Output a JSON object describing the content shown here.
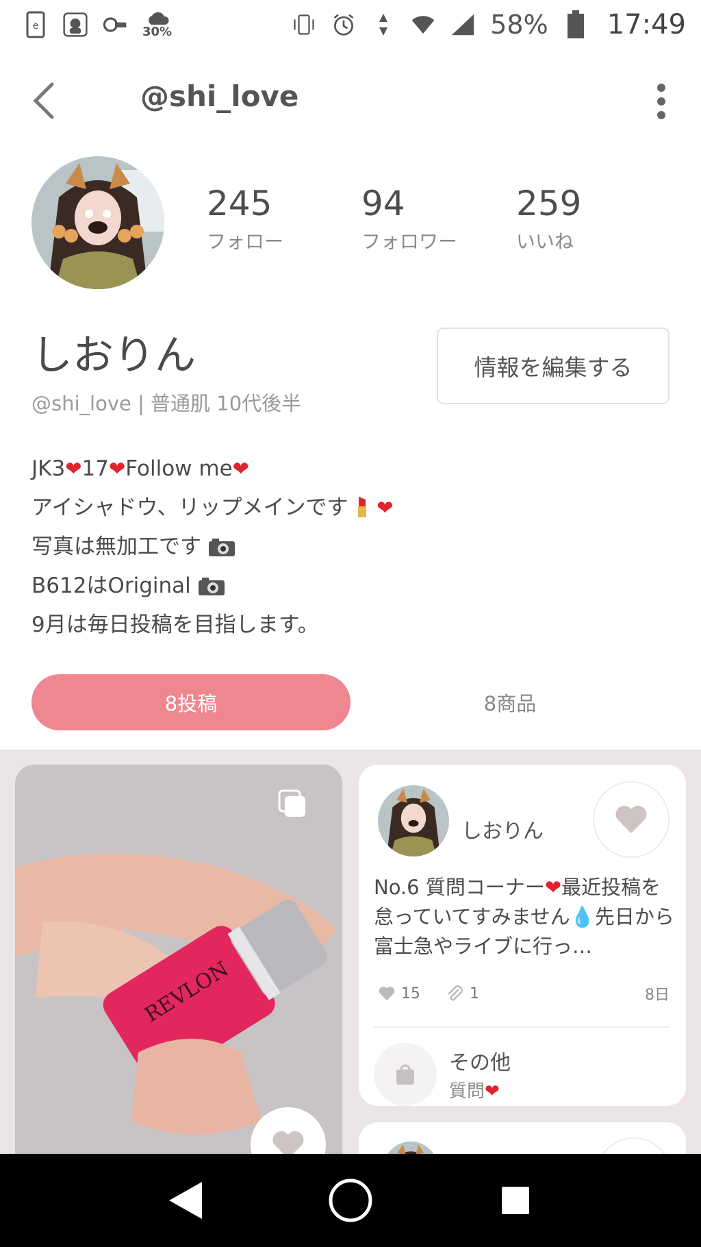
{
  "status_bar": {
    "weather_value": "30%",
    "battery": "58%",
    "time": "17:49"
  },
  "header": {
    "title": "@shi_love"
  },
  "profile": {
    "stats": [
      {
        "value": "245",
        "label": "フォロー"
      },
      {
        "value": "94",
        "label": "フォロワー"
      },
      {
        "value": "259",
        "label": "いいね"
      }
    ],
    "display_name": "しおりん",
    "handle_line": "@shi_love | 普通肌 10代後半",
    "edit_button": "情報を編集する",
    "bio": {
      "line1_a": "JK3",
      "line1_b": "17",
      "line1_c": "Follow me",
      "line2": "アイシャドウ、リップメインです",
      "line3": "写真は無加工です",
      "line4": "B612はOriginal",
      "line5": "9月は毎日投稿を目指します。"
    }
  },
  "tabs": [
    {
      "label": "8投稿",
      "active": true
    },
    {
      "label": "8商品",
      "active": false
    }
  ],
  "posts": {
    "card": {
      "user_name": "しおりん",
      "text_a": "No.6 質問コーナー",
      "text_b": "最近投稿を怠っていてすみません",
      "text_c": "先日から富士急やライブに行っ…",
      "likes": "15",
      "clips": "1",
      "age": "8日",
      "category": "その他",
      "category_sub": "質問"
    },
    "image_product_text": "REVLON"
  },
  "colors": {
    "accent": "#ee8790",
    "grid_background": "#ebe5e5"
  }
}
